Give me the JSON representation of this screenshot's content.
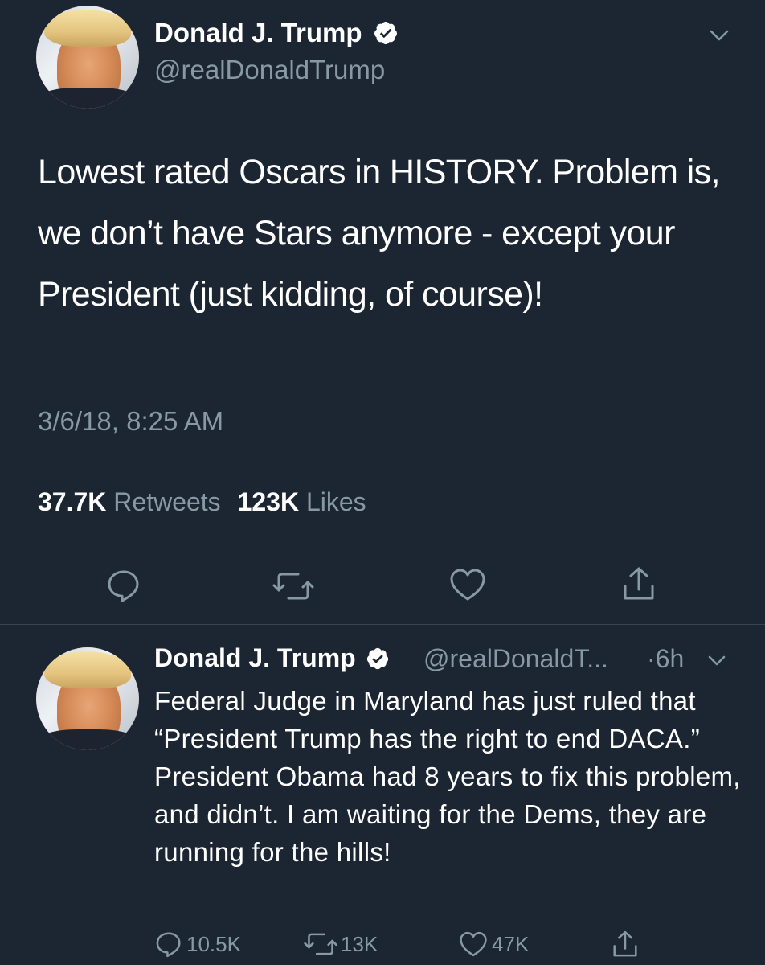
{
  "main_tweet": {
    "author_name": "Donald J. Trump",
    "author_handle": "@realDonaldTrump",
    "text": "Lowest rated Oscars in HISTORY. Problem is, we don’t have Stars anymore - except your President (just kidding, of course)!",
    "timestamp": "3/6/18, 8:25 AM",
    "retweets_count": "37.7K",
    "retweets_label": "Retweets",
    "likes_count": "123K",
    "likes_label": "Likes"
  },
  "second_tweet": {
    "author_name": "Donald J. Trump",
    "author_handle": "@realDonaldT...",
    "time_ago": "·6h",
    "text": "Federal Judge in Maryland has just ruled that “President Trump has the right to end DACA.” President Obama had 8 years to fix this problem, and didn’t. I am waiting for the Dems, they are running for the hills!",
    "reply_count": "10.5K",
    "retweet_count": "13K",
    "like_count": "47K"
  },
  "icons": [
    "verified-badge-icon",
    "chevron-down-icon",
    "reply-icon",
    "retweet-icon",
    "like-icon",
    "share-icon"
  ],
  "colors": {
    "background": "#1c2532",
    "text_primary": "#ffffff",
    "text_secondary": "#8899a6",
    "divider": "#38444d"
  }
}
